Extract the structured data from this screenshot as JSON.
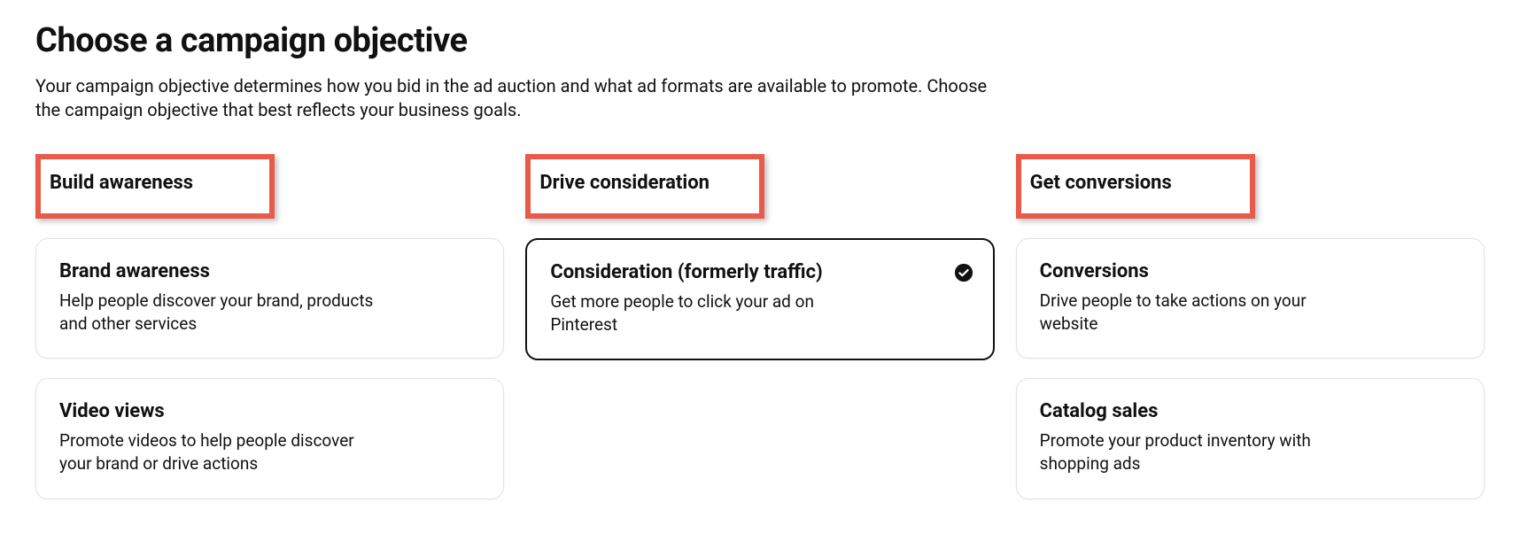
{
  "page": {
    "title": "Choose a campaign objective",
    "description": "Your campaign objective determines how you bid in the ad auction and what ad formats are available to promote. Choose the campaign objective that best reflects your business goals."
  },
  "columns": [
    {
      "heading": "Build awareness",
      "options": [
        {
          "title": "Brand awareness",
          "desc": "Help people discover your brand, products and other services",
          "selected": false
        },
        {
          "title": "Video views",
          "desc": "Promote videos to help people discover your brand or drive actions",
          "selected": false
        }
      ]
    },
    {
      "heading": "Drive consideration",
      "options": [
        {
          "title": "Consideration (formerly traffic)",
          "desc": "Get more people to click your ad on Pinterest",
          "selected": true
        }
      ]
    },
    {
      "heading": "Get conversions",
      "options": [
        {
          "title": "Conversions",
          "desc": "Drive people to take actions on your website",
          "selected": false
        },
        {
          "title": "Catalog sales",
          "desc": "Promote your product inventory with shopping ads",
          "selected": false
        }
      ]
    }
  ]
}
